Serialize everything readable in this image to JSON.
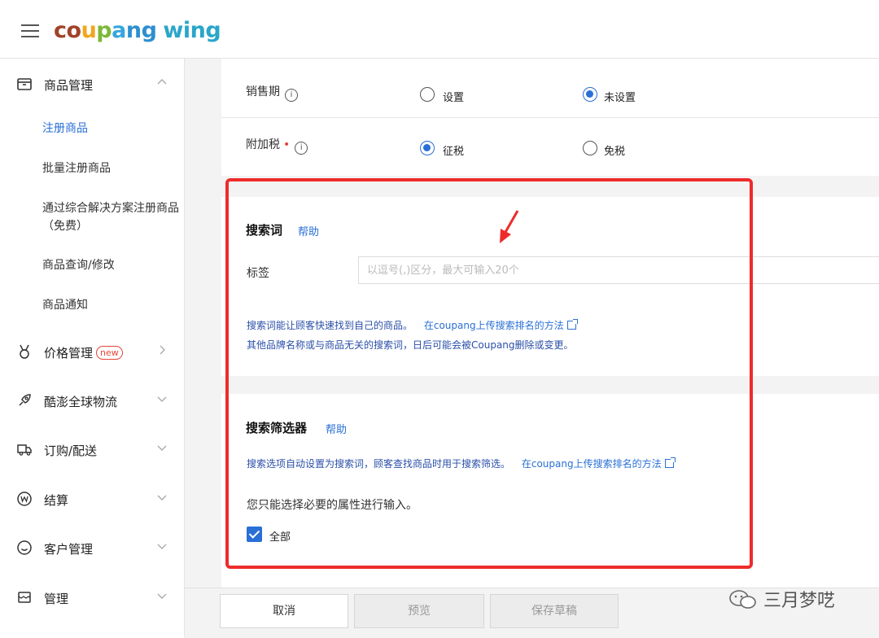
{
  "header": {
    "logo": {
      "p1": "co",
      "p2": "u",
      "p3": "p",
      "p4": "a",
      "p5": "ng",
      "wing": "wing"
    }
  },
  "sidebar": {
    "product_mgmt": "商品管理",
    "sub_items": [
      "注册商品",
      "批量注册商品",
      "通过综合解决方案注册商品",
      "（免费）",
      "商品查询/修改",
      "商品通知"
    ],
    "price_mgmt": "价格管理",
    "new_badge": "new",
    "logistics": "酷澎全球物流",
    "orders": "订购/配送",
    "settlement": "结算",
    "customers": "客户管理",
    "management": "管理"
  },
  "form": {
    "sales_period_label": "销售期",
    "sales_period_options": [
      "设置",
      "未设置"
    ],
    "sales_period_selected": "未设置",
    "surtax_label": "附加税",
    "surtax_options": [
      "征税",
      "免税"
    ],
    "surtax_selected": "征税"
  },
  "search_terms": {
    "title": "搜索词",
    "help": "帮助",
    "tag_label": "标签",
    "tag_placeholder": "以逗号(,)区分，最大可输入20个",
    "tag_value": "",
    "desc_line1": "搜索词能让顾客快速找到自己的商品。",
    "desc_link": "在coupang上传搜索排名的方法",
    "desc_line2": "其他品牌名称或与商品无关的搜索词，日后可能会被Coupang删除或变更。"
  },
  "search_filter": {
    "title": "搜索筛选器",
    "help": "帮助",
    "desc": "搜索选项自动设置为搜索词，顾客查找商品时用于搜索筛选。",
    "desc_link": "在coupang上传搜索排名的方法",
    "note": "您只能选择必要的属性进行输入。",
    "all_label": "全部",
    "all_checked": true
  },
  "footer": {
    "cancel": "取消",
    "preview": "预览",
    "save_draft": "保存草稿"
  },
  "watermark": "三月梦呓",
  "colors": {
    "accent": "#2a6fd6",
    "highlight": "#ee2b2b",
    "required": "#e5443a"
  }
}
